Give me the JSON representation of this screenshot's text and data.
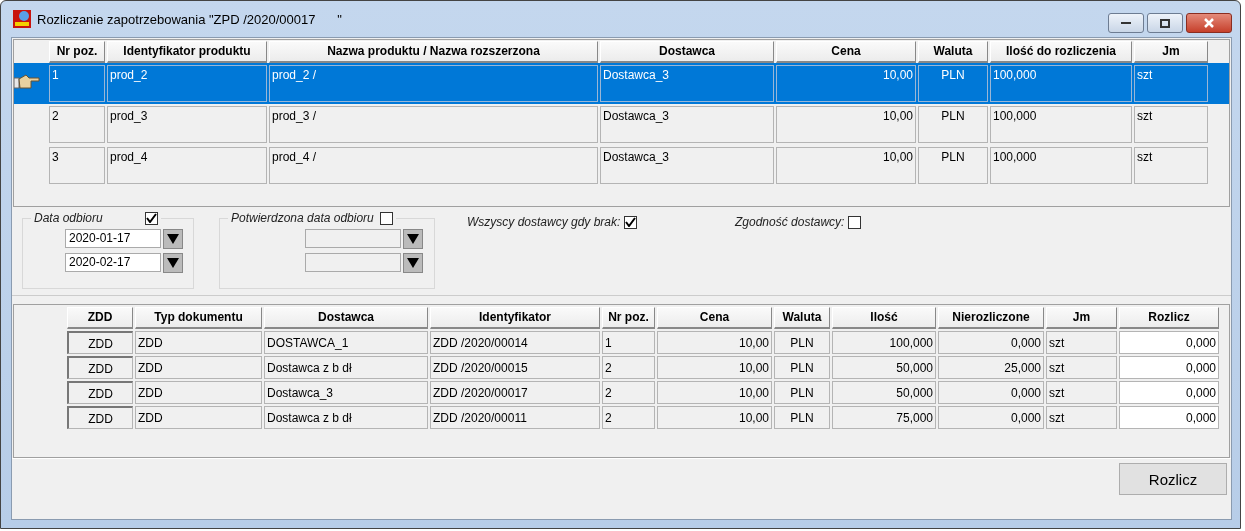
{
  "window": {
    "title": "Rozliczanie zapotrzebowania \"ZPD /2020/00017      \""
  },
  "items_table": {
    "columns": [
      {
        "label": "Nr poz.",
        "kind": "text"
      },
      {
        "label": "Identyfikator produktu",
        "kind": "text"
      },
      {
        "label": "Nazwa produktu / Nazwa rozszerzona",
        "kind": "text"
      },
      {
        "label": "Dostawca",
        "kind": "text"
      },
      {
        "label": "Cena",
        "kind": "number"
      },
      {
        "label": "Waluta",
        "kind": "center"
      },
      {
        "label": "Ilość do rozliczenia",
        "kind": "text"
      },
      {
        "label": "Jm",
        "kind": "text"
      }
    ],
    "rows": [
      {
        "selected": true,
        "cells": [
          "1",
          "prod_2",
          "prod_2 /",
          "Dostawca_3",
          "10,00",
          "PLN",
          "100,000",
          "szt"
        ]
      },
      {
        "selected": false,
        "cells": [
          "2",
          "prod_3",
          "prod_3 /",
          "Dostawca_3",
          "10,00",
          "PLN",
          "100,000",
          "szt"
        ]
      },
      {
        "selected": false,
        "cells": [
          "3",
          "prod_4",
          "prod_4 /",
          "Dostawca_3",
          "10,00",
          "PLN",
          "100,000",
          "szt"
        ]
      }
    ]
  },
  "filters": {
    "pickup_date": {
      "label": "Data odbioru",
      "checked": true,
      "dates": [
        "2020-01-17",
        "2020-02-17"
      ]
    },
    "confirmed_date": {
      "label": "Potwierdzona data odbioru",
      "checked": false
    },
    "options": [
      {
        "label": "Wszyscy dostawcy gdy brak:",
        "checked": true
      },
      {
        "label": "Zgodność dostawcy:",
        "checked": false
      }
    ]
  },
  "documents_table": {
    "columns": [
      {
        "label": "ZDD",
        "kind": "button"
      },
      {
        "label": "Typ dokumentu",
        "kind": "text"
      },
      {
        "label": "Dostawca",
        "kind": "text"
      },
      {
        "label": "Identyfikator",
        "kind": "text"
      },
      {
        "label": "Nr poz.",
        "kind": "text"
      },
      {
        "label": "Cena",
        "kind": "number"
      },
      {
        "label": "Waluta",
        "kind": "center"
      },
      {
        "label": "Ilość",
        "kind": "number"
      },
      {
        "label": "Nierozliczone",
        "kind": "number"
      },
      {
        "label": "Jm",
        "kind": "text"
      },
      {
        "label": "Rozlicz",
        "kind": "input"
      }
    ],
    "rows": [
      [
        "ZDD",
        "ZDD",
        "DOSTAWCA_1",
        "ZDD /2020/00014",
        "1",
        "10,00",
        "PLN",
        "100,000",
        "0,000",
        "szt",
        "0,000"
      ],
      [
        "ZDD",
        "ZDD",
        "Dostawca z b dł",
        "ZDD /2020/00015",
        "2",
        "10,00",
        "PLN",
        "50,000",
        "25,000",
        "szt",
        "0,000"
      ],
      [
        "ZDD",
        "ZDD",
        "Dostawca_3",
        "ZDD /2020/00017",
        "2",
        "10,00",
        "PLN",
        "50,000",
        "0,000",
        "szt",
        "0,000"
      ],
      [
        "ZDD",
        "ZDD",
        "Dostawca z b dł",
        "ZDD /2020/00011",
        "2",
        "10,00",
        "PLN",
        "75,000",
        "0,000",
        "szt",
        "0,000"
      ]
    ]
  },
  "buttons": [
    {
      "label": "Rozlicz"
    }
  ]
}
